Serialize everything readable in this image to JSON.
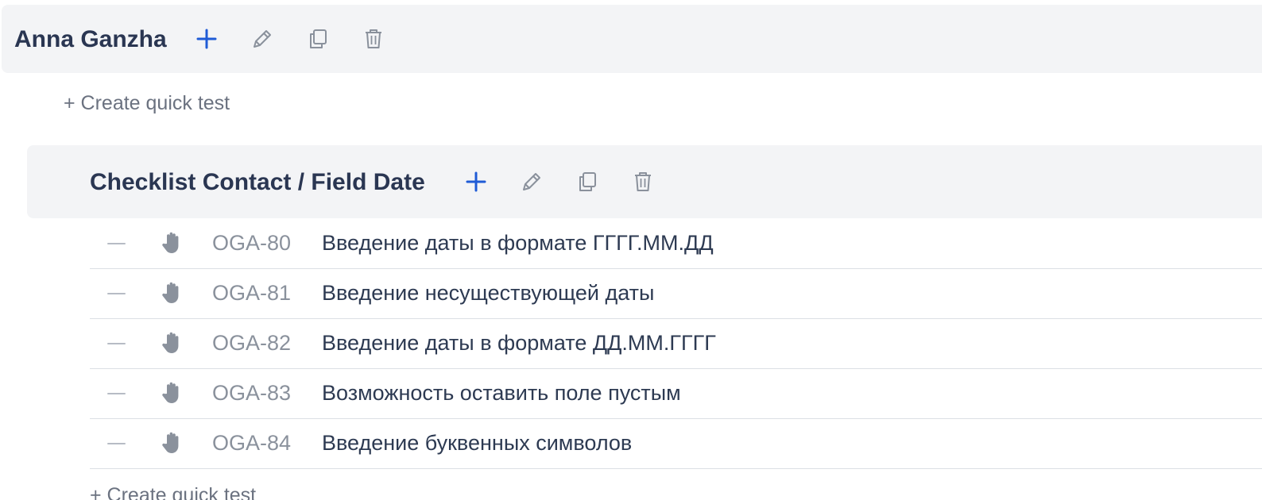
{
  "folder": {
    "title": "Anna Ganzha",
    "actions": [
      {
        "name": "add-icon"
      },
      {
        "name": "edit-icon"
      },
      {
        "name": "copy-icon"
      },
      {
        "name": "delete-icon"
      }
    ]
  },
  "quick_test_label": "+ Create quick test",
  "subfolder": {
    "title": "Checklist Contact / Field Date",
    "actions": [
      {
        "name": "add-icon"
      },
      {
        "name": "edit-icon"
      },
      {
        "name": "copy-icon"
      },
      {
        "name": "delete-icon"
      }
    ],
    "tests": [
      {
        "key": "OGA-80",
        "name": "Введение даты в формате ГГГГ.ММ.ДД"
      },
      {
        "key": "OGA-81",
        "name": "Введение несуществующей даты"
      },
      {
        "key": "OGA-82",
        "name": "Введение даты в формате ДД.ММ.ГГГГ"
      },
      {
        "key": "OGA-83",
        "name": "Возможность оставить поле пустым"
      },
      {
        "key": "OGA-84",
        "name": "Введение буквенных символов"
      }
    ],
    "quick_test_label": "+ Create quick test"
  },
  "colors": {
    "accent": "#1f5bd6",
    "icon_grey": "#8a919c",
    "header_bg": "#f3f4f6",
    "title": "#2a3652"
  }
}
